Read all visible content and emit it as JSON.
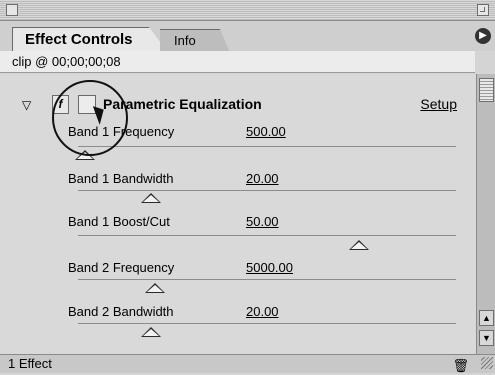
{
  "window": {
    "tabs": [
      "Effect Controls",
      "Info"
    ]
  },
  "clip": {
    "label": "clip @ 00;00;00;08"
  },
  "effect": {
    "fx_glyph": "f",
    "name": "Parametric Equalization",
    "setup_label": "Setup",
    "params": [
      {
        "label": "Band 1 Frequency",
        "value": "500.00"
      },
      {
        "label": "Band 1 Bandwidth",
        "value": "20.00"
      },
      {
        "label": "Band 1 Boost/Cut",
        "value": "50.00"
      },
      {
        "label": "Band 2 Frequency",
        "value": "5000.00"
      },
      {
        "label": "Band 2 Bandwidth",
        "value": "20.00"
      }
    ]
  },
  "status": {
    "text": "1 Effect"
  },
  "icons": {
    "trash": "trash-icon",
    "disclosure": "triangle-down-icon",
    "menu": "panel-menu-icon"
  }
}
